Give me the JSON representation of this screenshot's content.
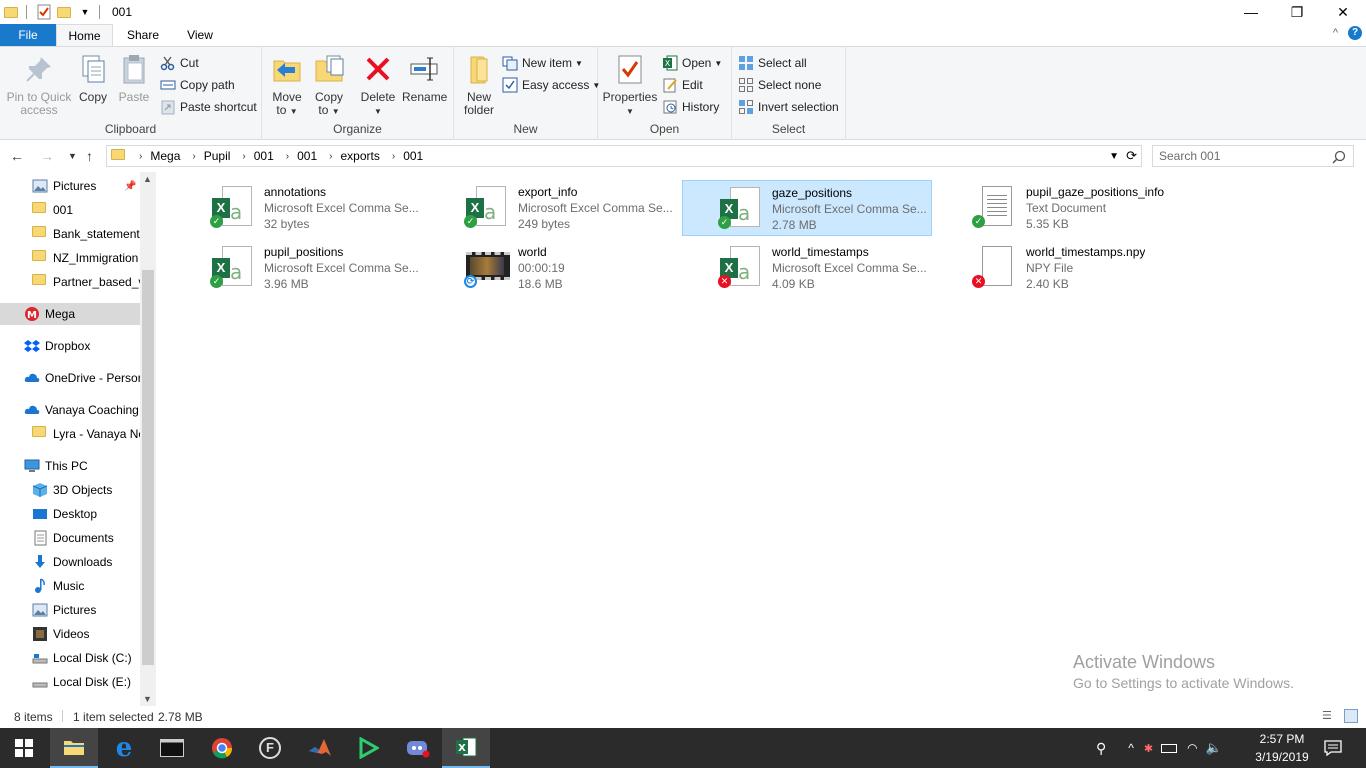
{
  "window": {
    "title": "001",
    "minimize": "—",
    "maximize": "❐",
    "close": "✕"
  },
  "tabs": {
    "file": "File",
    "home": "Home",
    "share": "Share",
    "view": "View",
    "collapse": "^",
    "help": "?"
  },
  "ribbon": {
    "clipboard": {
      "label": "Clipboard",
      "pin": "Pin to Quick access",
      "copy": "Copy",
      "paste": "Paste",
      "cut": "Cut",
      "copy_path": "Copy path",
      "paste_shortcut": "Paste shortcut"
    },
    "organize": {
      "label": "Organize",
      "move_to": "Move to",
      "copy_to": "Copy to",
      "delete": "Delete",
      "rename": "Rename"
    },
    "new": {
      "label": "New",
      "new_folder": "New folder",
      "new_item": "New item",
      "easy_access": "Easy access"
    },
    "open": {
      "label": "Open",
      "properties": "Properties",
      "open": "Open",
      "edit": "Edit",
      "history": "History"
    },
    "select": {
      "label": "Select",
      "select_all": "Select all",
      "select_none": "Select none",
      "invert": "Invert selection"
    }
  },
  "address": {
    "crumbs": [
      "Mega",
      "Pupil",
      "001",
      "001",
      "exports",
      "001"
    ],
    "search_placeholder": "Search 001"
  },
  "nav": {
    "items": [
      {
        "label": "Pictures"
      },
      {
        "label": "001"
      },
      {
        "label": "Bank_statements"
      },
      {
        "label": "NZ_Immigration"
      },
      {
        "label": "Partner_based_v"
      },
      {
        "label": "Mega"
      },
      {
        "label": "Dropbox"
      },
      {
        "label": "OneDrive - Persor"
      },
      {
        "label": "Vanaya Coaching"
      },
      {
        "label": "Lyra - Vanaya Ne"
      },
      {
        "label": "This PC"
      },
      {
        "label": "3D Objects"
      },
      {
        "label": "Desktop"
      },
      {
        "label": "Documents"
      },
      {
        "label": "Downloads"
      },
      {
        "label": "Music"
      },
      {
        "label": "Pictures"
      },
      {
        "label": "Videos"
      },
      {
        "label": "Local Disk (C:)"
      },
      {
        "label": "Local Disk (E:)"
      }
    ]
  },
  "files": [
    {
      "name": "annotations",
      "type": "Microsoft Excel Comma Se...",
      "size": "32 bytes"
    },
    {
      "name": "export_info",
      "type": "Microsoft Excel Comma Se...",
      "size": "249 bytes"
    },
    {
      "name": "gaze_positions",
      "type": "Microsoft Excel Comma Se...",
      "size": "2.78 MB"
    },
    {
      "name": "pupil_gaze_positions_info",
      "type": "Text Document",
      "size": "5.35 KB"
    },
    {
      "name": "pupil_positions",
      "type": "Microsoft Excel Comma Se...",
      "size": "3.96 MB"
    },
    {
      "name": "world",
      "type": "00:00:19",
      "size": "18.6 MB"
    },
    {
      "name": "world_timestamps",
      "type": "Microsoft Excel Comma Se...",
      "size": "4.09 KB"
    },
    {
      "name": "world_timestamps.npy",
      "type": "NPY File",
      "size": "2.40 KB"
    }
  ],
  "status": {
    "count": "8 items",
    "selected": "1 item selected",
    "selected_size": "2.78 MB"
  },
  "watermark": {
    "line1": "Activate Windows",
    "line2": "Go to Settings to activate Windows."
  },
  "clock": {
    "time": "2:57 PM",
    "date": "3/19/2019"
  },
  "colors": {
    "accent": "#1979ca",
    "selection": "#cce8ff",
    "excel": "#1e7145",
    "taskbar": "#2b2b2b"
  }
}
